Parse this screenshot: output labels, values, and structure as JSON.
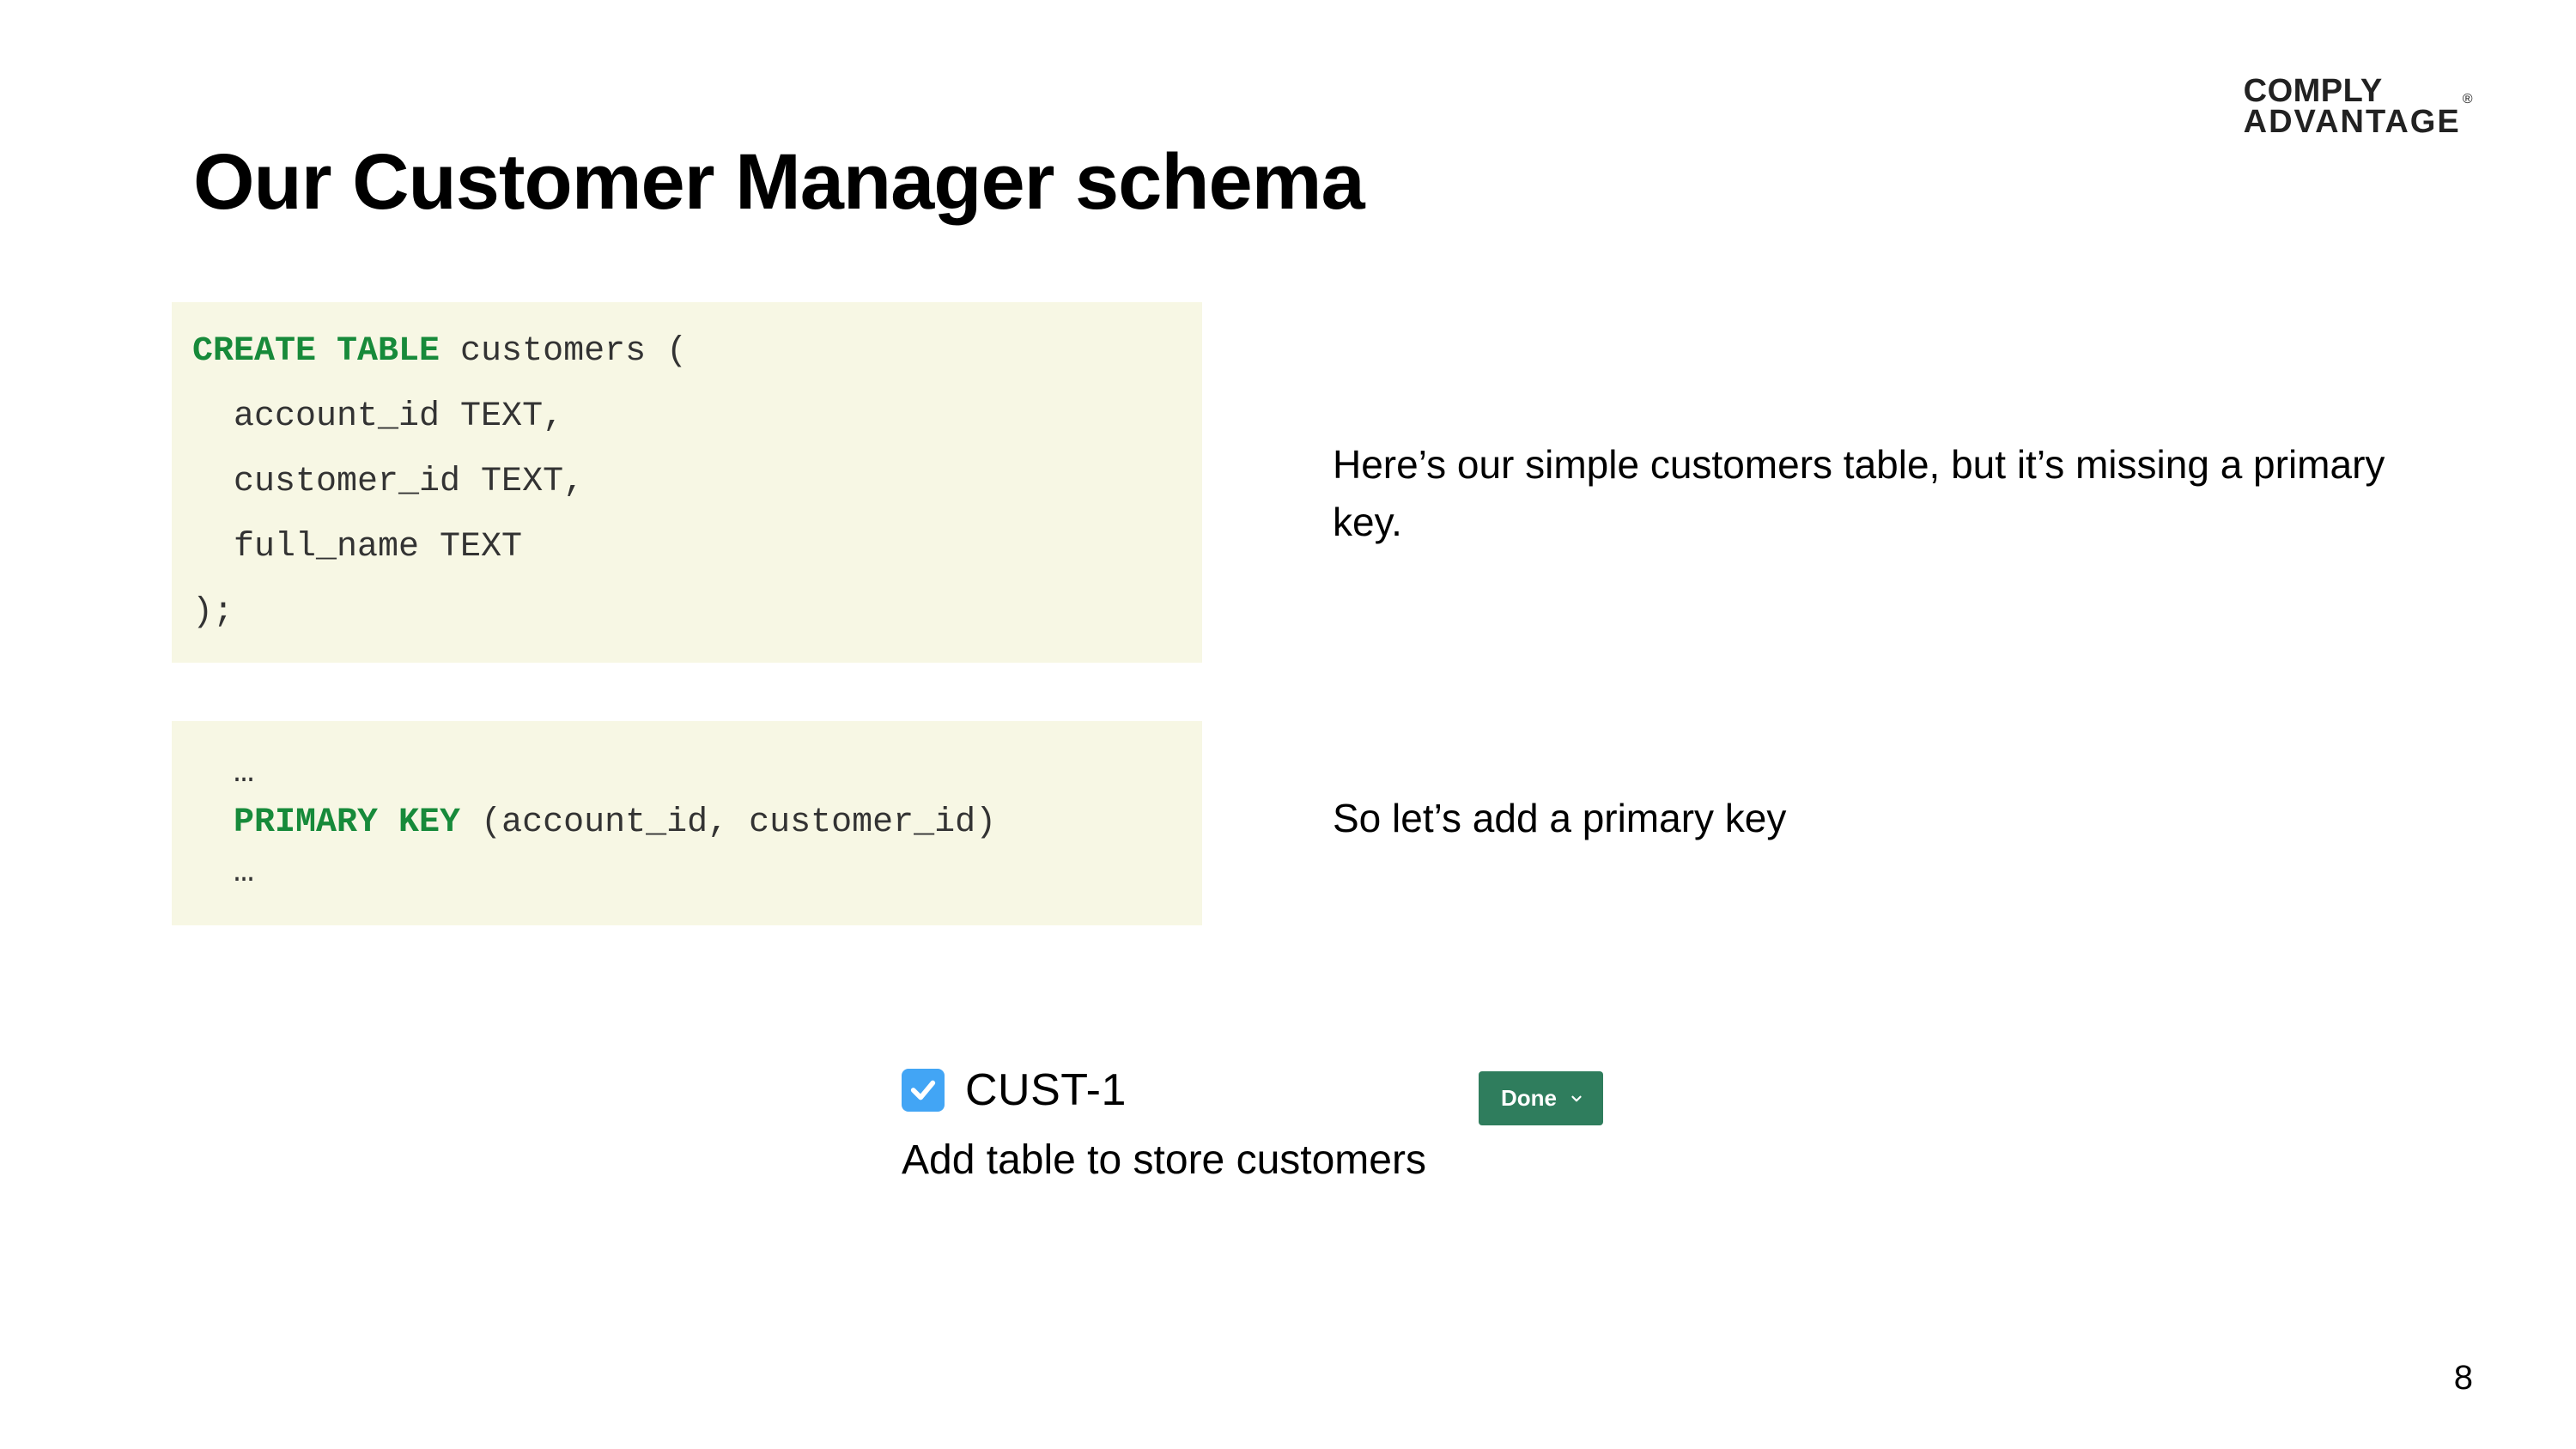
{
  "logo": {
    "line1": "COMPLY",
    "line2": "ADVANTAGE"
  },
  "title": "Our Customer Manager schema",
  "code1": {
    "l1_kw": "CREATE TABLE",
    "l1_rest": " customers (",
    "l2": "  account_id TEXT,",
    "l3": "  customer_id TEXT,",
    "l4": "  full_name TEXT",
    "l5": ");"
  },
  "code2": {
    "l1": "  …",
    "l2_kw": "PRIMARY KEY",
    "l2_rest": " (account_id, customer_id)",
    "l3": "  …"
  },
  "note1": "Here’s our simple customers table, but it’s missing a primary key.",
  "note2": "So let’s add a primary key",
  "ticket": {
    "id": "CUST-1",
    "desc": "Add table to store customers",
    "status": "Done"
  },
  "page": "8"
}
